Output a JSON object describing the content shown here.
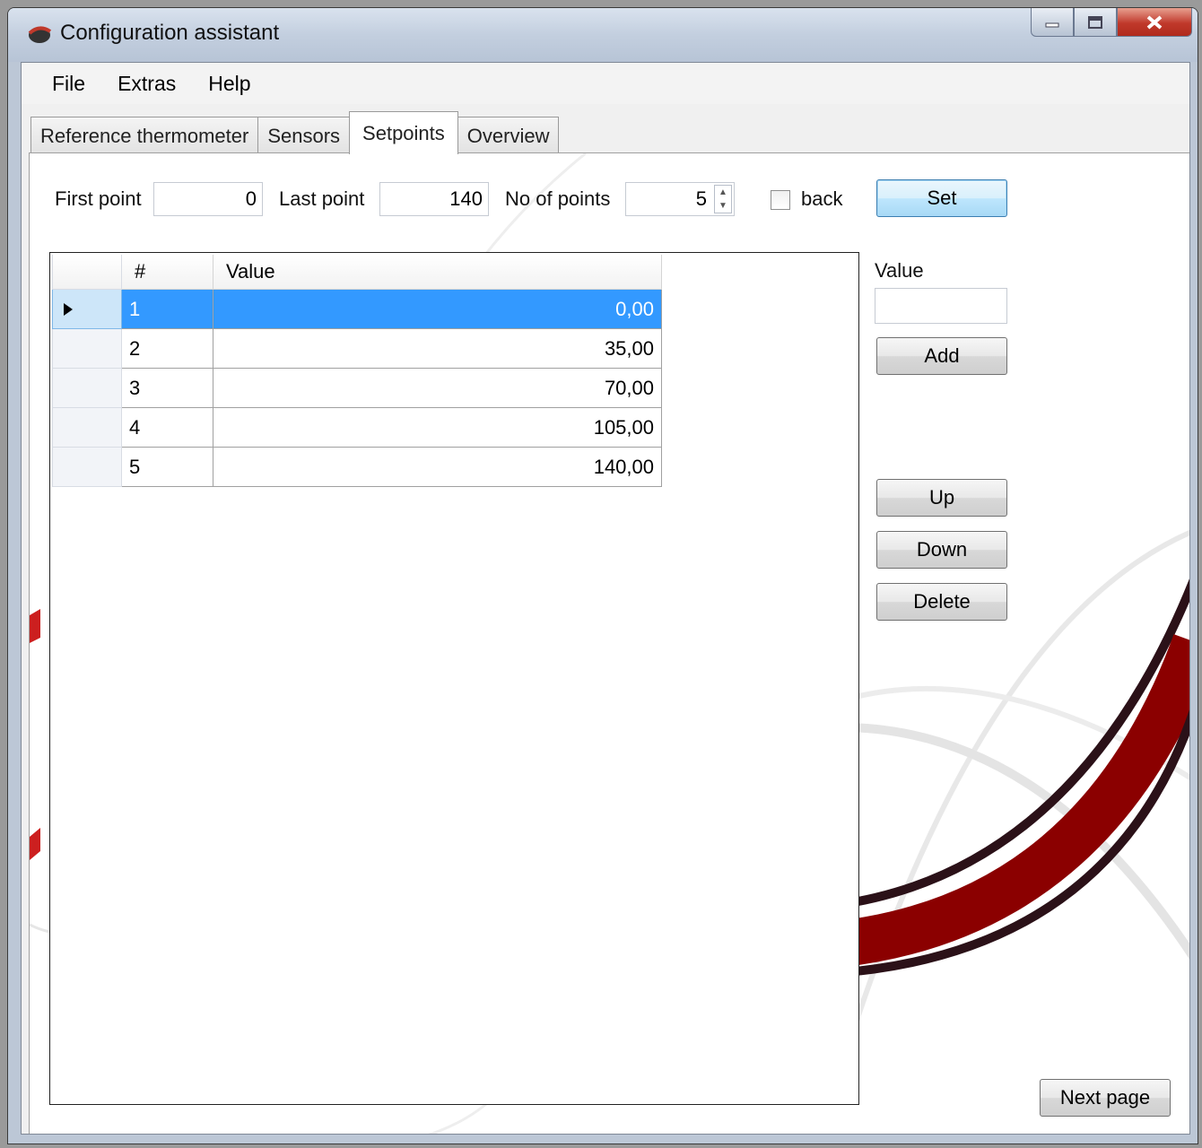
{
  "window": {
    "title": "Configuration assistant"
  },
  "menu": {
    "items": [
      "File",
      "Extras",
      "Help"
    ]
  },
  "tabs": [
    "Reference thermometer",
    "Sensors",
    "Setpoints",
    "Overview"
  ],
  "setpoints": {
    "first_point_label": "First point",
    "first_point_value": "0",
    "last_point_label": "Last point",
    "last_point_value": "140",
    "no_of_points_label": "No of points",
    "no_of_points_value": "5",
    "back_label": "back",
    "back_checked": false,
    "set_button": "Set"
  },
  "grid": {
    "columns": [
      "#",
      "Value"
    ],
    "rows": [
      {
        "num": "1",
        "value": "0,00",
        "selected": true
      },
      {
        "num": "2",
        "value": "35,00"
      },
      {
        "num": "3",
        "value": "70,00"
      },
      {
        "num": "4",
        "value": "105,00"
      },
      {
        "num": "5",
        "value": "140,00"
      }
    ]
  },
  "side": {
    "value_label": "Value",
    "value_input": "",
    "add_button": "Add",
    "up_button": "Up",
    "down_button": "Down",
    "delete_button": "Delete"
  },
  "next_page_button": "Next page",
  "colors": {
    "selection": "#3399ff",
    "swoosh": "#8b0000",
    "close_button": "#c0392b"
  }
}
